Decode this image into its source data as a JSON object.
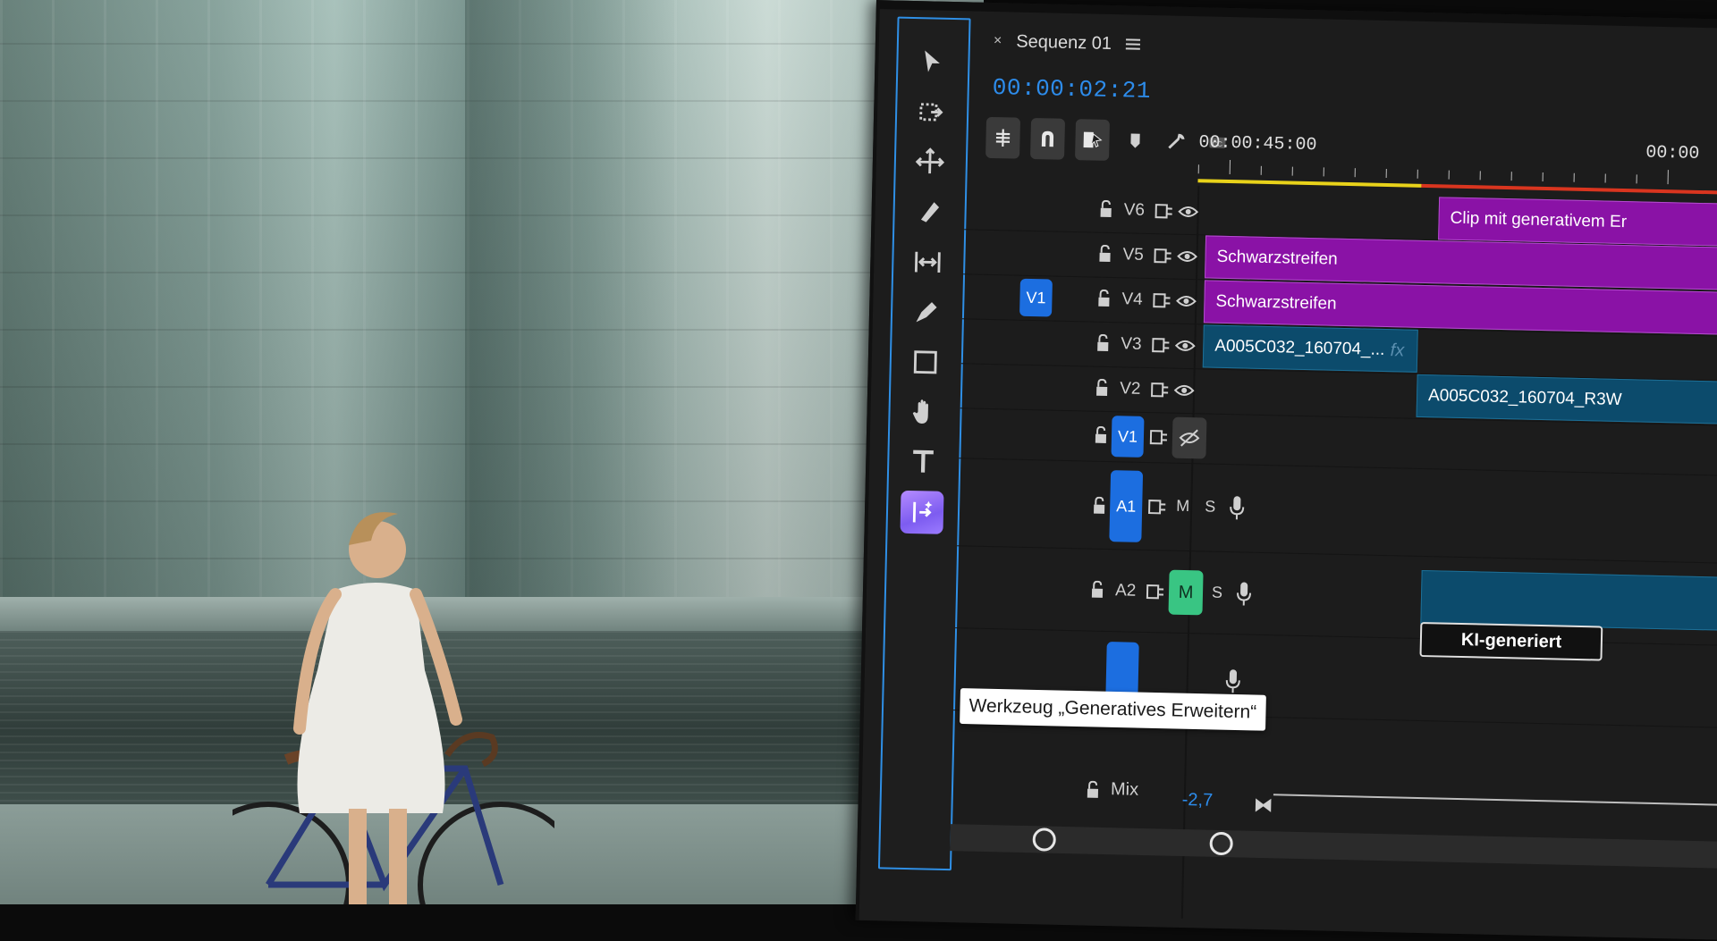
{
  "sequence": {
    "close_glyph": "×",
    "title": "Sequenz 01",
    "timecode": "00:00:02:21"
  },
  "ruler": {
    "time_start": "00:00:45:00",
    "time_end": "00:00"
  },
  "tooltip": {
    "text": "Werkzeug „Generatives Erweitern“"
  },
  "tracks": {
    "v6": {
      "name": "V6"
    },
    "v5": {
      "name": "V5"
    },
    "v4": {
      "name": "V4",
      "source_target": "V1"
    },
    "v3": {
      "name": "V3"
    },
    "v2": {
      "name": "V2"
    },
    "v1": {
      "name": "V1"
    },
    "a1": {
      "name": "A1",
      "m": "M",
      "s": "S"
    },
    "a2": {
      "name": "A2",
      "m": "M",
      "s": "S"
    }
  },
  "clips": {
    "gen_clip": "Clip mit generativem Er",
    "schwarz1": "Schwarzstreifen",
    "schwarz2": "Schwarzstreifen",
    "a005_1": "A005C032_160704_...",
    "a005_fx": "fx",
    "a005_2": "A005C032_160704_R3W",
    "ki_label": "KI-generiert"
  },
  "mix": {
    "label": "Mix",
    "value": "-2,7"
  },
  "icons": {
    "tools": [
      "selection-tool-icon",
      "track-select-icon",
      "ripple-edit-icon",
      "razor-icon",
      "slip-icon",
      "pen-icon",
      "rectangle-icon",
      "hand-icon",
      "type-icon",
      "generative-extend-icon"
    ]
  },
  "colors": {
    "accent_blue": "#2d8ceb",
    "clip_purple": "#8a12a6",
    "clip_teal": "#0c4b6c",
    "mute_green": "#39c583",
    "work_yellow": "#e8d21a",
    "work_red": "#d9351f",
    "gen_tool": "#9b7bff"
  }
}
